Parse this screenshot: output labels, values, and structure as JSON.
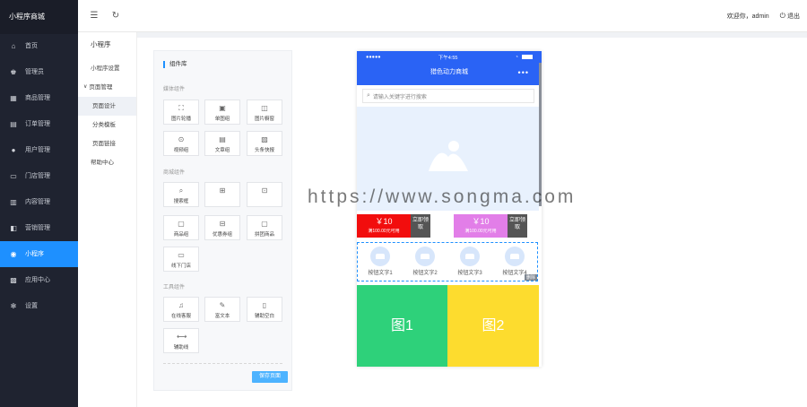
{
  "sidebar": {
    "brand": "小程序商城",
    "items": [
      {
        "label": "首页",
        "icon": "home-icon",
        "glyph": "⌂"
      },
      {
        "label": "管理员",
        "icon": "admin-icon",
        "glyph": "♚"
      },
      {
        "label": "商品管理",
        "icon": "gift-icon",
        "glyph": "▦"
      },
      {
        "label": "订单管理",
        "icon": "order-icon",
        "glyph": "▤"
      },
      {
        "label": "用户管理",
        "icon": "user-icon",
        "glyph": "●"
      },
      {
        "label": "门店管理",
        "icon": "store-icon",
        "glyph": "▭"
      },
      {
        "label": "内容管理",
        "icon": "document-icon",
        "glyph": "▥"
      },
      {
        "label": "营销管理",
        "icon": "marketing-icon",
        "glyph": "◧"
      },
      {
        "label": "小程序",
        "icon": "miniprogram-icon",
        "glyph": "◉",
        "active": true
      },
      {
        "label": "应用中心",
        "icon": "apps-icon",
        "glyph": "▩"
      },
      {
        "label": "设置",
        "icon": "gear-icon",
        "glyph": "✻"
      }
    ]
  },
  "topbar": {
    "menu_glyph": "☰",
    "refresh_glyph": "↻",
    "welcome": "欢迎你，admin",
    "logout": "退出"
  },
  "submenu": {
    "title": "小程序",
    "settings": "小程序设置",
    "page_manage": "页面管理",
    "page_design": "页面设计",
    "category_template": "分类模板",
    "page_link": "页面链接",
    "help": "帮助中心"
  },
  "library": {
    "title": "组件库",
    "sections": {
      "media": "媒体组件",
      "mall": "商城组件",
      "tools": "工具组件"
    },
    "components": [
      {
        "label": "图片轮播",
        "icon": "carousel-icon",
        "glyph": "⛶"
      },
      {
        "label": "单图组",
        "icon": "image-icon",
        "glyph": "▣"
      },
      {
        "label": "图片橱窗",
        "icon": "window-icon",
        "glyph": "◫"
      },
      {
        "label": "视频组",
        "icon": "video-icon",
        "glyph": "⊙"
      },
      {
        "label": "文章组",
        "icon": "article-icon",
        "glyph": "▤"
      },
      {
        "label": "头条快报",
        "icon": "news-icon",
        "glyph": "▨"
      },
      {
        "label": "搜索框",
        "icon": "search-icon",
        "glyph": "⌕"
      },
      {
        "label": "",
        "icon": "nav-icon",
        "glyph": "⊞"
      },
      {
        "label": "",
        "icon": "grid-icon",
        "glyph": "⊡"
      },
      {
        "label": "商品组",
        "icon": "goods-icon",
        "glyph": "▢"
      },
      {
        "label": "优惠券组",
        "icon": "coupon-icon",
        "glyph": "⊟"
      },
      {
        "label": "拼团商品",
        "icon": "group-buy-icon",
        "glyph": "▢"
      },
      {
        "label": "线下门店",
        "icon": "offline-store-icon",
        "glyph": "▭"
      },
      {
        "label": "在线客服",
        "icon": "service-icon",
        "glyph": "♫"
      },
      {
        "label": "富文本",
        "icon": "richtext-icon",
        "glyph": "✎"
      },
      {
        "label": "辅助空白",
        "icon": "blank-icon",
        "glyph": "▯"
      },
      {
        "label": "辅助线",
        "icon": "line-icon",
        "glyph": "⟷"
      }
    ],
    "save": "保存页面"
  },
  "phone": {
    "signal": "●●●●●",
    "time": "下午4:55",
    "title": "猎色动力商城",
    "more": "•••",
    "search_placeholder": "请输入关键字进行搜索",
    "coupons": [
      {
        "amount": "￥10",
        "cond": "满100.00元可用",
        "action": "立即领取",
        "color": "#f20d0d"
      },
      {
        "amount": "￥10",
        "cond": "满100.00元可用",
        "action": "立即领取",
        "color": "#e27ee8"
      }
    ],
    "buttons": [
      "按钮文字1",
      "按钮文字2",
      "按钮文字3",
      "按钮文字4"
    ],
    "delete_tag": "删除",
    "pictures": [
      {
        "label": "图1",
        "color": "#2ed17a"
      },
      {
        "label": "图2",
        "color": "#fddc2e"
      }
    ]
  },
  "watermark": "https://www.songma.com"
}
